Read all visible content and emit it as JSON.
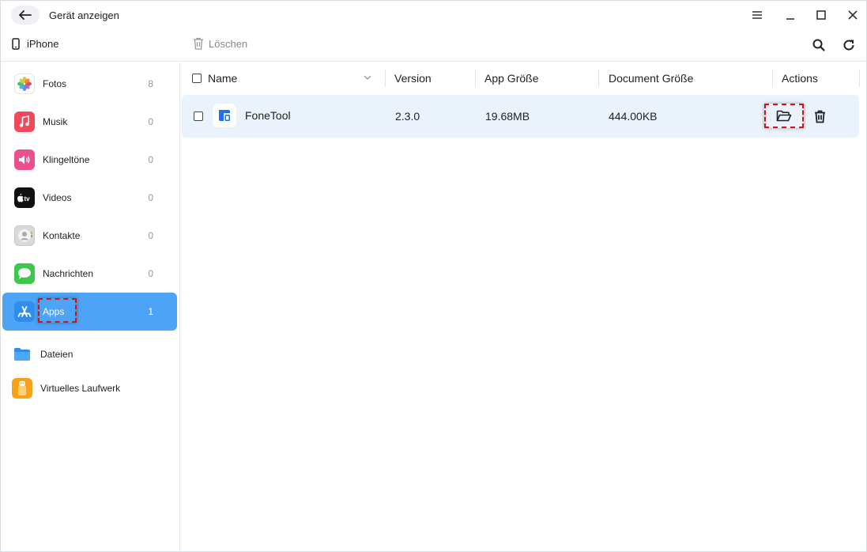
{
  "window": {
    "title": "Gerät anzeigen"
  },
  "toolbar": {
    "device_name": "iPhone",
    "delete_label": "Löschen"
  },
  "sidebar": {
    "items": [
      {
        "label": "Fotos",
        "count": "8"
      },
      {
        "label": "Musik",
        "count": "0"
      },
      {
        "label": "Klingeltöne",
        "count": "0"
      },
      {
        "label": "Videos",
        "count": "0"
      },
      {
        "label": "Kontakte",
        "count": "0"
      },
      {
        "label": "Nachrichten",
        "count": "0"
      },
      {
        "label": "Apps",
        "count": "1",
        "active": true
      }
    ],
    "extra_items": [
      {
        "label": "Dateien"
      },
      {
        "label": "Virtuelles Laufwerk"
      }
    ]
  },
  "table": {
    "columns": [
      "Name",
      "Version",
      "App Größe",
      "Document Größe",
      "Actions"
    ],
    "rows": [
      {
        "name": "FoneTool",
        "version": "2.3.0",
        "app_size": "19.68MB",
        "doc_size": "444.00KB"
      }
    ]
  },
  "colors": {
    "accent": "#4da3f5",
    "row_highlight": "#eaf3fc",
    "annotation": "#d0121b"
  },
  "icons": [
    "back-arrow-icon",
    "menu-icon",
    "minimize-icon",
    "maximize-icon",
    "close-icon",
    "phone-icon",
    "trash-icon",
    "search-icon",
    "refresh-icon",
    "photos-icon",
    "music-icon",
    "ringtone-icon",
    "appletv-icon",
    "contacts-icon",
    "messages-icon",
    "appstore-icon",
    "folder-icon",
    "usb-drive-icon",
    "fonetool-logo-icon",
    "open-folder-icon"
  ]
}
